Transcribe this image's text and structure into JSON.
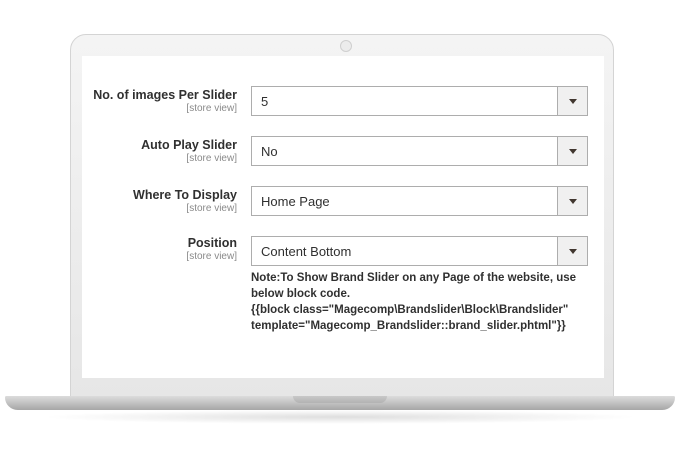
{
  "fields": [
    {
      "label": "No. of images Per Slider",
      "scope": "[store view]",
      "value": "5"
    },
    {
      "label": "Auto Play Slider",
      "scope": "[store view]",
      "value": "No"
    },
    {
      "label": "Where To Display",
      "scope": "[store view]",
      "value": "Home Page"
    },
    {
      "label": "Position",
      "scope": "[store view]",
      "value": "Content Bottom"
    }
  ],
  "note": {
    "line1": "Note:To Show Brand Slider on any Page of the website, use",
    "line2": "below block code.",
    "line3": "{{block class=\"Magecomp\\Brandslider\\Block\\Brandslider\"",
    "line4": "template=\"Magecomp_Brandslider::brand_slider.phtml\"}}"
  }
}
